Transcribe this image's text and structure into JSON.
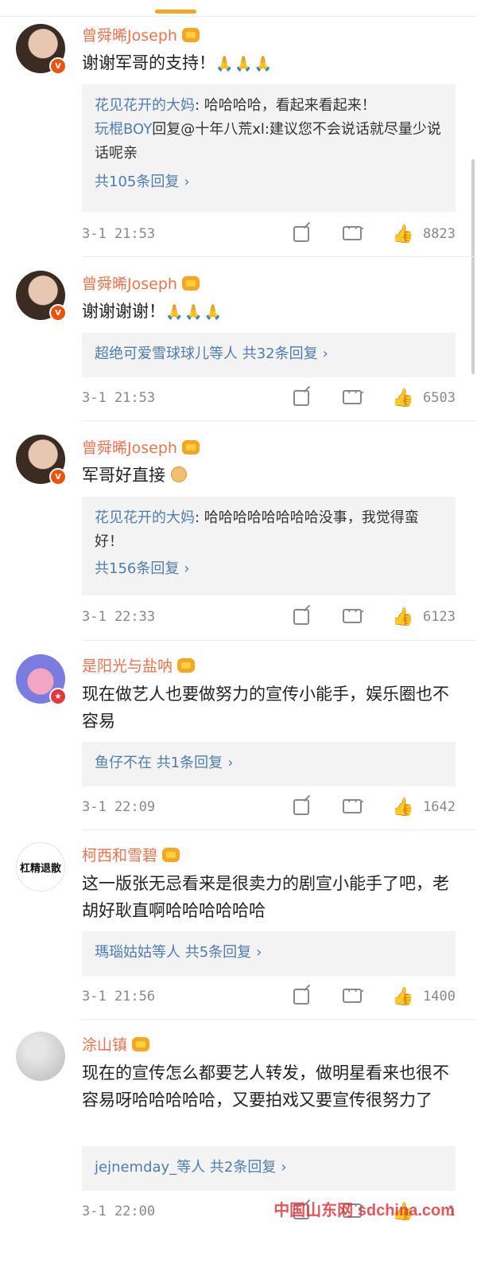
{
  "comments": [
    {
      "username": "曾舜晞Joseph",
      "text": "谢谢军哥的支持！",
      "emoji": "🙏🙏🙏",
      "replies": [
        {
          "name": "花见花开的大妈",
          "text": ": 哈哈哈哈，看起来看起来！"
        },
        {
          "name": "玩棍BOY",
          "text": "回复@十年八荒xl:建议您不会说话就尽量少说话呢亲"
        }
      ],
      "reply_link": "共105条回复",
      "time": "3-1 21:53",
      "likes": "8823"
    },
    {
      "username": "曾舜晞Joseph",
      "text": "谢谢谢谢！",
      "emoji": "🙏🙏🙏",
      "reply_link": "超绝可爱雪球球儿等人 共32条回复",
      "time": "3-1 21:53",
      "likes": "6503"
    },
    {
      "username": "曾舜晞Joseph",
      "text": "军哥好直接",
      "replies": [
        {
          "name": "花见花开的大妈",
          "text": ": 哈哈哈哈哈哈哈哈没事，我觉得蛮好！"
        }
      ],
      "reply_link": "共156条回复",
      "time": "3-1 22:33",
      "likes": "6123"
    },
    {
      "username": "是阳光与盐呐",
      "text": "现在做艺人也要做努力的宣传小能手，娱乐圈也不容易",
      "reply_link": "鱼仔不在 共1条回复",
      "time": "3-1 22:09",
      "likes": "1642"
    },
    {
      "username": "柯西和雪碧",
      "avatar_text": "杠精退散",
      "text": "这一版张无忌看来是很卖力的剧宣小能手了吧，老胡好耿直啊哈哈哈哈哈哈",
      "reply_link": "瑪瑙姑姑等人 共5条回复",
      "time": "3-1 21:56",
      "likes": "1400"
    },
    {
      "username": "涂山镇",
      "text": "现在的宣传怎么都要艺人转发，做明星看来也很不容易呀哈哈哈哈哈，又要拍戏又要宣传很努力了",
      "reply_link": "jejnemday_等人 共2条回复",
      "time": "3-1 22:00",
      "likes": "1"
    }
  ],
  "watermark": "中国山东网 sdchina.com",
  "chevron": "›"
}
